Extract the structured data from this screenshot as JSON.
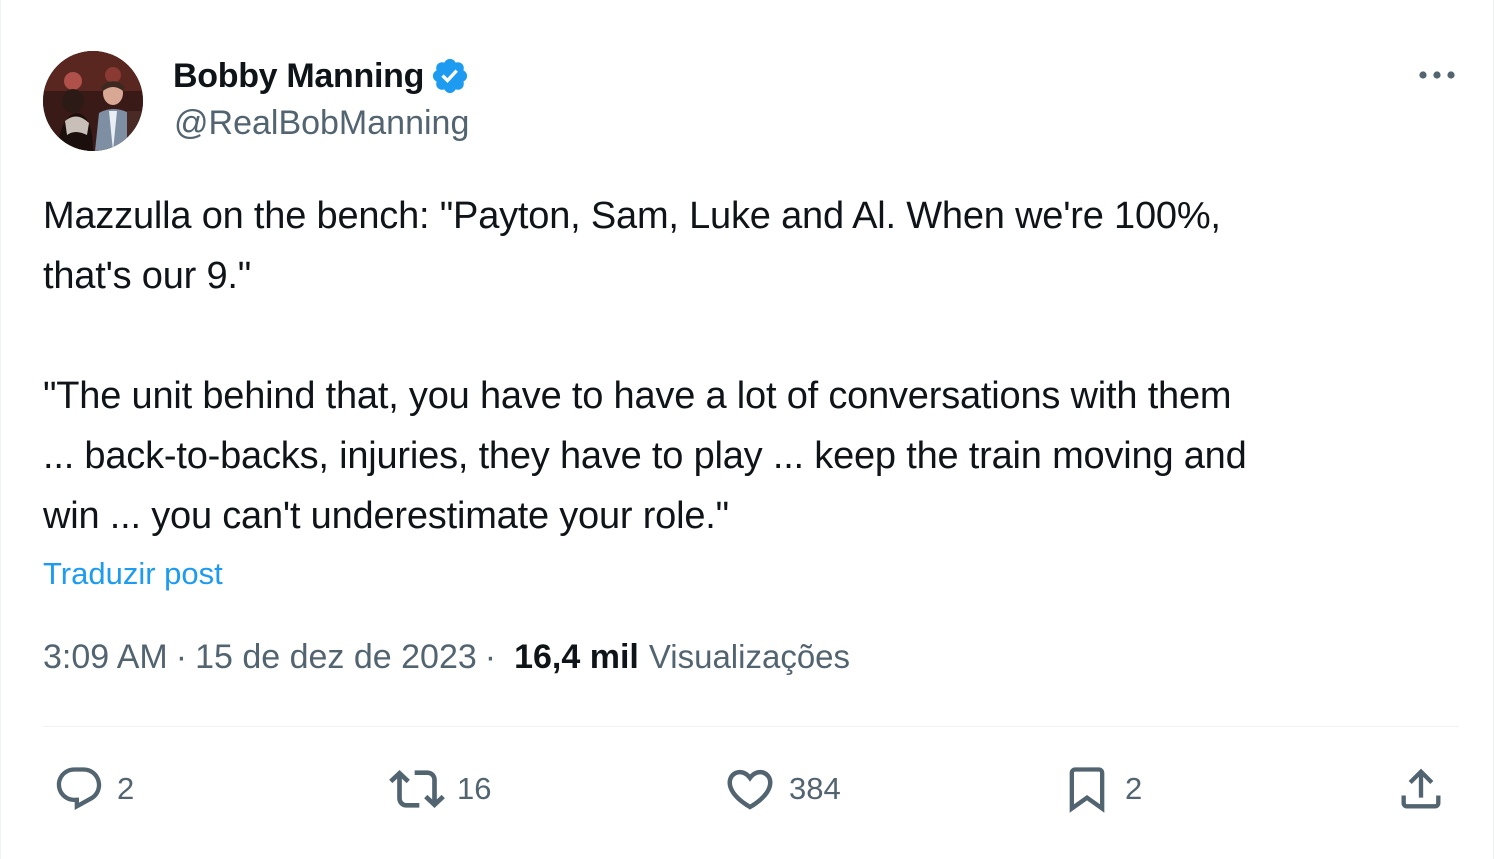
{
  "author": {
    "display_name": "Bobby Manning",
    "handle": "@RealBobManning",
    "verified": true,
    "verified_color": "#1d9bf0"
  },
  "tweet": {
    "paragraphs": [
      [
        "Mazzulla on the bench: \"Payton, Sam, Luke and Al. When we're 100%,",
        "that's our 9.\""
      ],
      [
        "\"The unit behind that, you have to have a lot of conversations with them",
        "... back-to-backs, injuries, they have to play ... keep the train moving and",
        "win ... you can't underestimate your role.\""
      ]
    ],
    "translate_label": "Traduzir post"
  },
  "meta": {
    "time": "3:09 AM",
    "date": "15 de dez de 2023",
    "separator": "·",
    "views_count": "16,4 mil",
    "views_label": "Visualizações"
  },
  "actions": {
    "reply": {
      "icon": "reply-icon",
      "count": "2"
    },
    "retweet": {
      "icon": "retweet-icon",
      "count": "16"
    },
    "like": {
      "icon": "heart-icon",
      "count": "384"
    },
    "bookmark": {
      "icon": "bookmark-icon",
      "count": "2"
    },
    "share": {
      "icon": "share-icon"
    }
  },
  "colors": {
    "text_primary": "#0f1419",
    "text_secondary": "#536471",
    "link": "#1d9bf0",
    "divider": "#eff3f4"
  }
}
